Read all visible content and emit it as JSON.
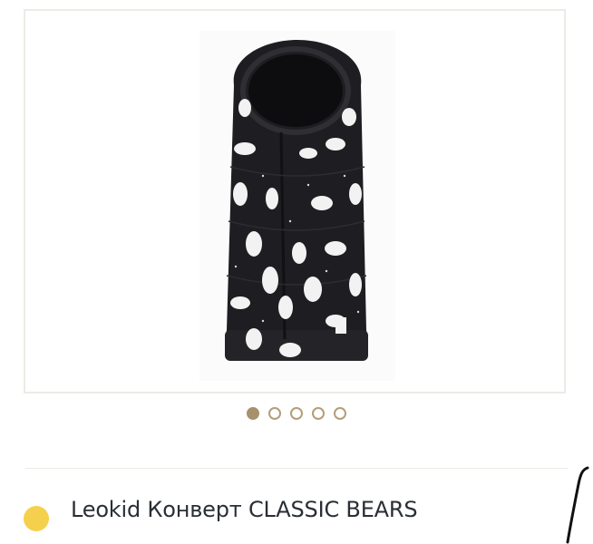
{
  "gallery": {
    "image_icon": "sleeping-bag-image",
    "slide_count": 5,
    "active_slide": 1
  },
  "product": {
    "title": "Leokid Конверт CLASSIC BEARS",
    "status_color": "#f5d04d"
  },
  "colors": {
    "accent": "#a8906c",
    "text": "#2a2e35",
    "border": "#ecebe6"
  }
}
